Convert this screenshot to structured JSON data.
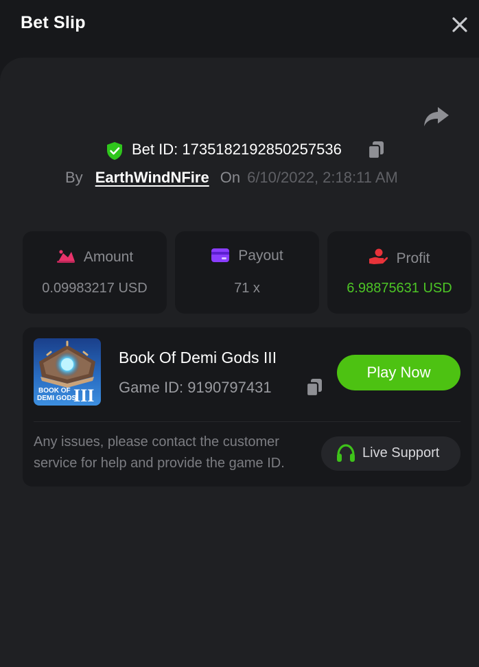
{
  "header": {
    "title": "Bet Slip"
  },
  "bet": {
    "id_label": "Bet ID: 1735182192850257536",
    "by_label": "By",
    "username": "EarthWindNFire",
    "on_label": "On",
    "datetime": "6/10/2022, 2:18:11 AM"
  },
  "stats": [
    {
      "label": "Amount",
      "value": "0.09983217 USD",
      "icon": "amount-icon",
      "icon_color": "#e8336b"
    },
    {
      "label": "Payout",
      "value": "71 x",
      "icon": "payout-card-icon",
      "icon_color": "#8a3dff"
    },
    {
      "label": "Profit",
      "value": "6.98875631 USD",
      "icon": "profit-hand-icon",
      "icon_color": "#e8333a",
      "value_color": "#4dc526"
    }
  ],
  "game": {
    "name": "Book Of Demi Gods III",
    "id_label": "Game ID: 9190797431",
    "thumb_text_line1": "BOOK OF",
    "thumb_text_line2": "DEMI GODS",
    "thumb_numeral": "III",
    "play_label": "Play Now"
  },
  "support": {
    "notice": "Any issues, please contact the customer service for help and provide the game ID.",
    "button_label": "Live Support"
  },
  "colors": {
    "accent_green": "#4dc212",
    "shield_green": "#2fc61c",
    "background": "#17181b",
    "panel": "#1f2023"
  }
}
